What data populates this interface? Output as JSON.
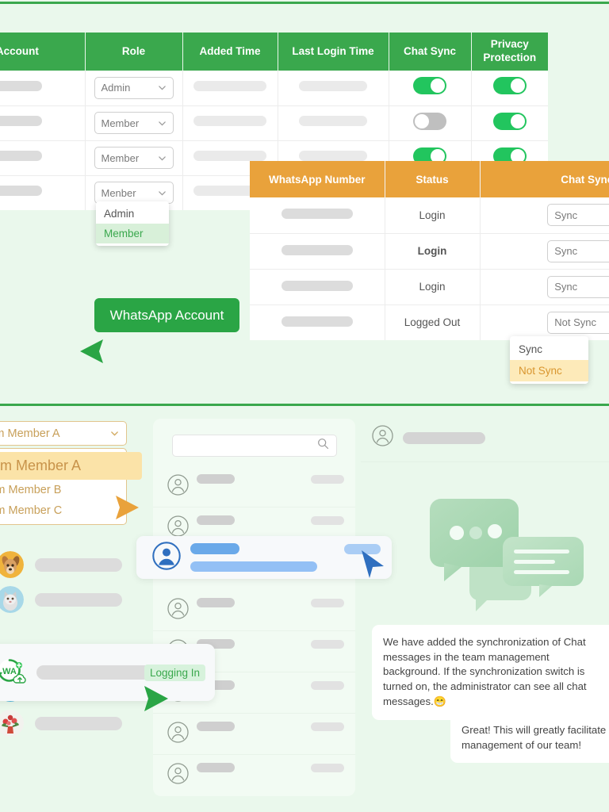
{
  "colors": {
    "page_bg": "#eaf8ec",
    "green_header": "#3aa84d",
    "orange_header": "#e9a23b",
    "toggle_on": "#22c55e",
    "toggle_off": "#bfbfbf",
    "status_login_green": "#2aa545",
    "status_logged_out_red": "#e05a5a",
    "blue_accent": "#6aa9e9"
  },
  "team_table": {
    "columns": [
      "ADesk Account",
      "Role",
      "Added Time",
      "Last Login Time",
      "Chat Sync",
      "Privacy Protection"
    ],
    "rows": [
      {
        "role": "Admin",
        "chat_sync": "on",
        "privacy": "on"
      },
      {
        "role": "Member",
        "chat_sync": "off",
        "privacy": "on"
      },
      {
        "role": "Member",
        "chat_sync": "on",
        "privacy": "on"
      },
      {
        "role": "Menber",
        "chat_sync": "on",
        "privacy": "on"
      }
    ],
    "role_options": [
      "Admin",
      "Member"
    ],
    "role_selected": "Member"
  },
  "whatsapp_table": {
    "columns": [
      "WhatsApp Number",
      "Status",
      "Chat Sync"
    ],
    "rows": [
      {
        "status": "Login",
        "status_style": "normal",
        "sync": "Sync"
      },
      {
        "status": "Login",
        "status_style": "green-bold",
        "sync": "Sync"
      },
      {
        "status": "Login",
        "status_style": "normal",
        "sync": "Sync"
      },
      {
        "status": "Logged Out",
        "status_style": "red",
        "sync": "Not Sync"
      }
    ],
    "sync_options": [
      "Sync",
      "Not Sync"
    ],
    "sync_selected": "Not Sync"
  },
  "wa_button": {
    "label": "WhatsApp Account"
  },
  "team_member_select": {
    "value": "Team Member A",
    "options": [
      "Team Member A",
      "Team Member B",
      "Team Member C"
    ],
    "selected": "Team Member A"
  },
  "search": {
    "placeholder": ""
  },
  "logging_card": {
    "badge": "Logging In",
    "avatar_label": "WA"
  },
  "chat": {
    "messages": [
      {
        "side": "in",
        "text": "We have added the synchronization of Chat messages in the team management background. If the synchronization switch is turned on, the administrator can see all chat messages.",
        "emoji": "😁"
      },
      {
        "side": "out",
        "text": "Great! This will greatly facilitate management of our team!",
        "emoji": ""
      }
    ]
  }
}
